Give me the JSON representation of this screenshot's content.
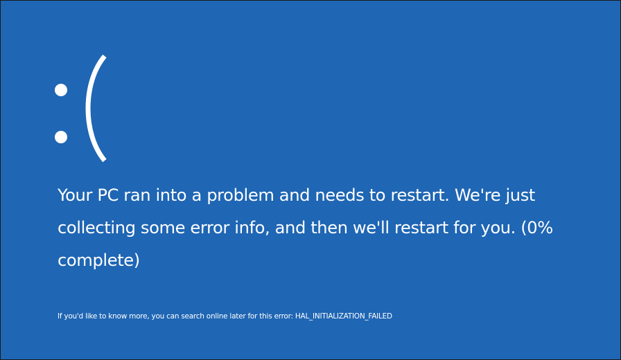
{
  "screen": {
    "background_color": "#1f66b4",
    "text_color": "#ffffff"
  },
  "face": {
    "emoticon": ":(",
    "icon": "sad-face-icon"
  },
  "message": {
    "lines": [
      "Your PC ran into a problem and needs to restart. We're just",
      "collecting some error info, and then we'll restart for you. (0%",
      "complete)"
    ],
    "progress_percent": 0
  },
  "info": {
    "text": "If you'd like to know more, you can search online later for this error: HAL_INITIALIZATION_FAILED"
  }
}
